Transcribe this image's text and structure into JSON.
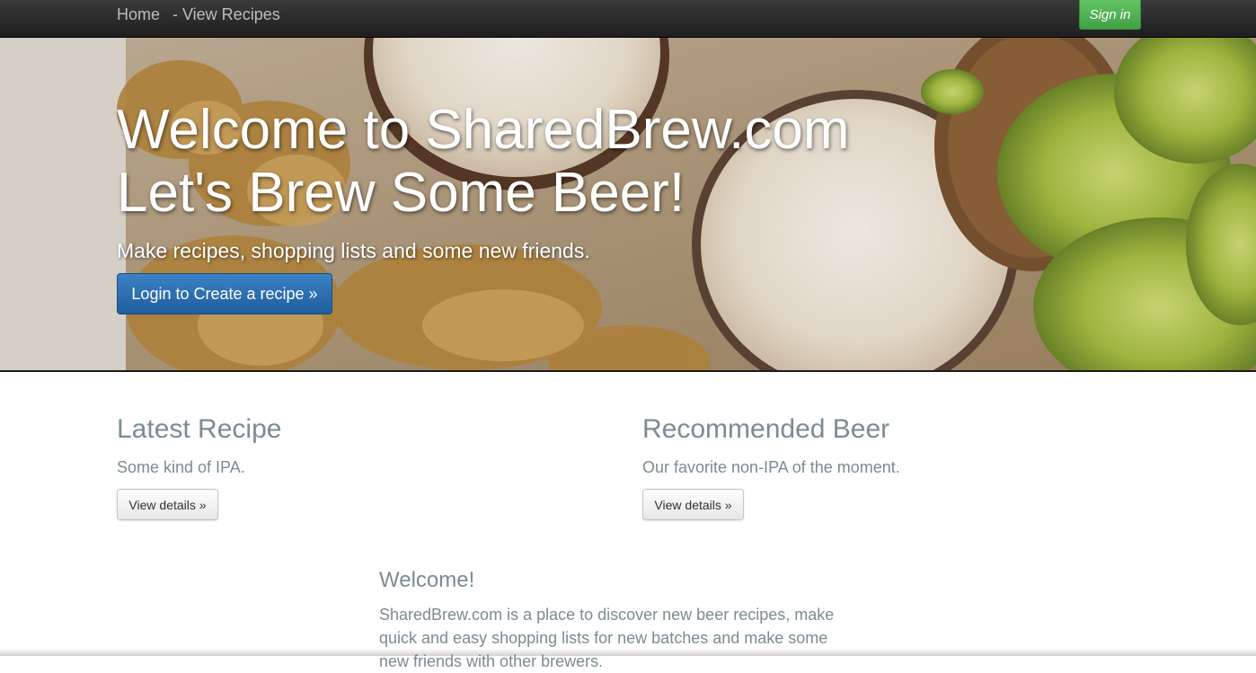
{
  "navbar": {
    "home_label": "Home",
    "recipes_label": "- View Recipes",
    "signin_label": "Sign in"
  },
  "hero": {
    "title_line1": "Welcome to SharedBrew.com",
    "title_line2": "Let's Brew Some Beer!",
    "subtitle": "Make recipes, shopping lists and some new friends.",
    "cta_label": "Login to Create a recipe »"
  },
  "columns": [
    {
      "title": "Latest Recipe",
      "text": "Some kind of IPA.",
      "button_label": "View details »"
    },
    {
      "title": "Recommended Beer",
      "text": "Our favorite non-IPA of the moment.",
      "button_label": "View details »"
    }
  ],
  "welcome": {
    "title": "Welcome!",
    "text": "SharedBrew.com is a place to discover new beer recipes, make quick and easy shopping lists for new batches and make some new friends with other brewers."
  },
  "colors": {
    "navbar_bg": "#2a2a2a",
    "signin_green": "#4cae4c",
    "cta_blue": "#2a6fb2",
    "muted_text": "#7b8c93"
  }
}
